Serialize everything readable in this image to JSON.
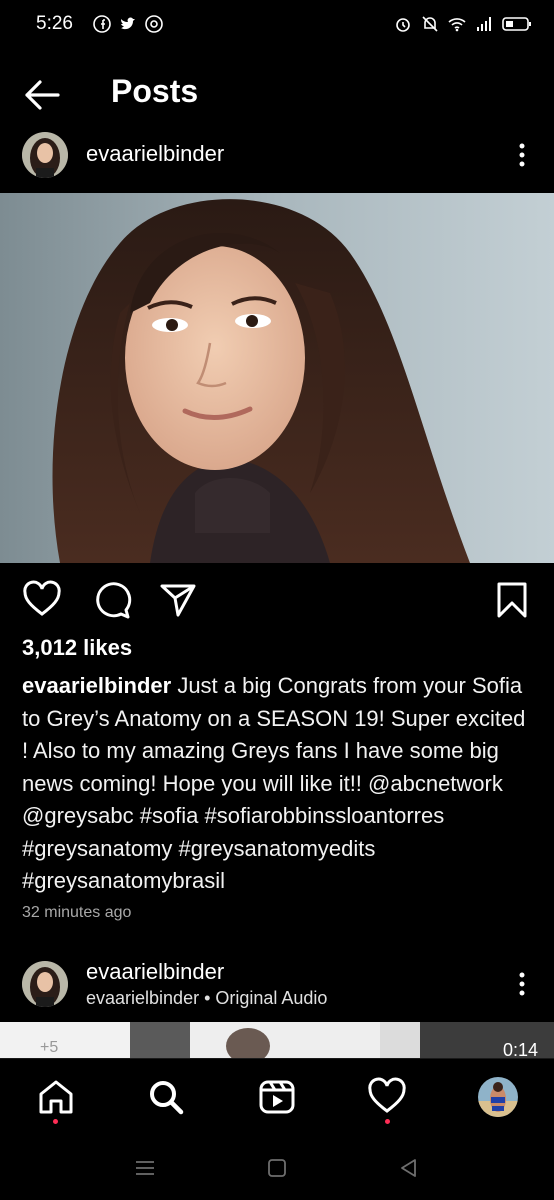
{
  "status_bar": {
    "time": "5:26",
    "left_icons": [
      "facebook-icon",
      "twitter-icon",
      "chrome-icon"
    ],
    "right_icons": [
      "alarm-icon",
      "mute-icon",
      "wifi-icon",
      "signal-icon",
      "battery-icon"
    ]
  },
  "header": {
    "title": "Posts"
  },
  "post": {
    "username": "evaarielbinder",
    "likes": "3,012 likes",
    "caption_user": "evaarielbinder",
    "caption_text": "Just a big Congrats from your Sofia to Grey’s Anatomy on a SEASON 19! Super excited ! Also to my amazing Greys fans I have some big news coming! Hope you will like it!! @abcnetwork @greysabc #sofia #sofiarobbinssloantorres #greysanatomy #greysanatomyedits #greysanatomybrasil",
    "timestamp": "32 minutes ago"
  },
  "next_post": {
    "username": "evaarielbinder",
    "subtitle": "evaarielbinder • Original Audio",
    "duration": "0:14"
  },
  "colors": {
    "background": "#000000",
    "text": "#f5f5f5",
    "muted": "#a8a8a8",
    "notification_dot": "#ff2d55"
  }
}
